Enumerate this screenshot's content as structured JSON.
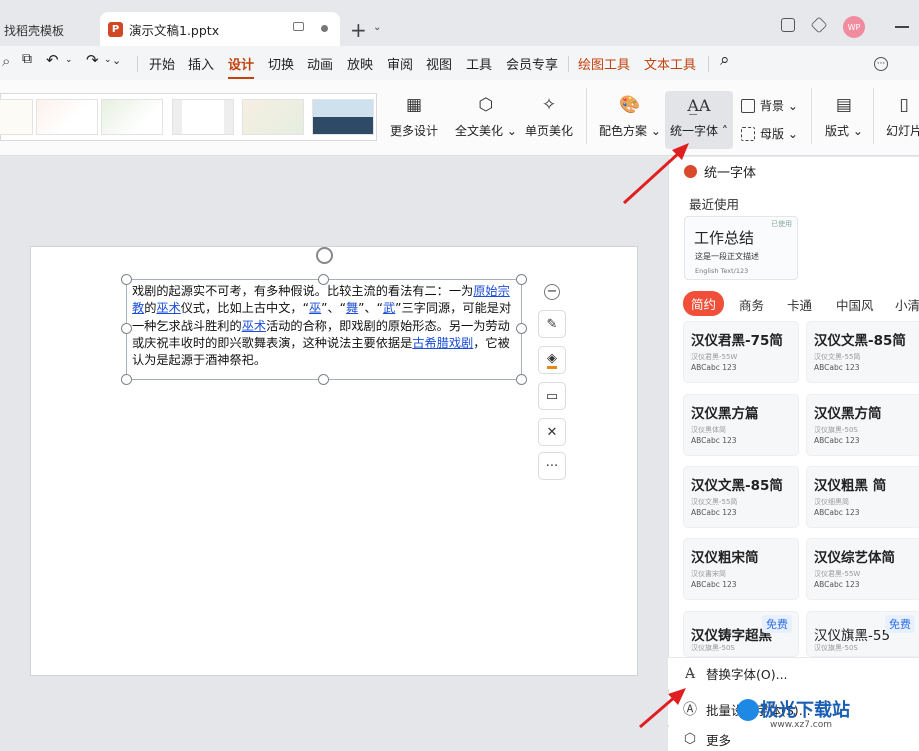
{
  "tabs": {
    "inactive_label": "找稻壳模板",
    "active_label": "演示文稿1.pptx",
    "ppt_icon": "P"
  },
  "menu": {
    "items": [
      "开始",
      "插入",
      "设计",
      "切换",
      "动画",
      "放映",
      "审阅",
      "视图",
      "工具",
      "会员专享"
    ],
    "active": "设计",
    "contextual": [
      "绘图工具",
      "文本工具"
    ]
  },
  "ribbon": {
    "more_design": "更多设计",
    "full_beautify": "全文美化",
    "single_beautify": "单页美化",
    "color_scheme": "配色方案",
    "unify_font": "统一字体",
    "background": "背景",
    "master": "母版",
    "layout": "版式",
    "slide_size": "幻灯片"
  },
  "slide": {
    "text_runs": [
      {
        "t": "戏剧的起源实不可考，有多种假说。比较主流的看法有二：一为"
      },
      {
        "t": "原始宗教",
        "link": true
      },
      {
        "t": "的"
      },
      {
        "t": "巫术",
        "link": true
      },
      {
        "t": "仪式，比如上古中文，“"
      },
      {
        "t": "巫",
        "link": true
      },
      {
        "t": "”、“"
      },
      {
        "t": "舞",
        "link": true
      },
      {
        "t": "”、“"
      },
      {
        "t": "武",
        "link": true
      },
      {
        "t": "”三字同源，可能是对一种乞求战斗胜利的"
      },
      {
        "t": "巫术",
        "link": true
      },
      {
        "t": "活动的合称，即戏剧的原始形态。另一为劳动或庆祝丰收时的即兴歌舞表演，这种说法主要依据是"
      },
      {
        "t": "古希腊戏剧",
        "link": true
      },
      {
        "t": "，它被认为是起源于酒神祭祀。"
      }
    ]
  },
  "panel": {
    "title": "统一字体",
    "recent_label": "最近使用",
    "recent_card": {
      "name": "工作总结",
      "sample": "这是一段正文描述",
      "english": "English Text/123",
      "tag": "已使用"
    },
    "categories": [
      "简约",
      "商务",
      "卡通",
      "中国风",
      "小清"
    ],
    "active_category": "简约",
    "fonts": [
      {
        "name": "汉仪君黑-75简",
        "sub": "汉仪君黑-55W",
        "eng": "ABCabc 123",
        "badge": ""
      },
      {
        "name": "汉仪文黑-85简",
        "sub": "汉仪文黑-55简",
        "eng": "ABCabc 123",
        "badge": ""
      },
      {
        "name": "汉仪黑方篇",
        "sub": "汉仪黑体简",
        "eng": "ABCabc 123",
        "badge": ""
      },
      {
        "name": "汉仪黑方简",
        "sub": "汉仪旗黑-50S",
        "eng": "ABCabc 123",
        "badge": ""
      },
      {
        "name": "汉仪文黑-85简",
        "sub": "汉仪文黑-55简",
        "eng": "ABCabc 123",
        "badge": ""
      },
      {
        "name": "汉仪粗黑 简",
        "sub": "汉仪细黑简",
        "eng": "ABCabc 123",
        "badge": ""
      },
      {
        "name": "汉仪粗宋简",
        "sub": "汉仪書宋简",
        "eng": "ABCabc 123",
        "badge": ""
      },
      {
        "name": "汉仪综艺体简",
        "sub": "汉仪君黑-55W",
        "eng": "ABCabc 123",
        "badge": ""
      },
      {
        "name": "汉仪铸字超黑",
        "sub": "汉仪旗黑-50S",
        "eng": "",
        "badge": "免费"
      },
      {
        "name": "汉仪旗黑-55",
        "sub": "汉仪旗黑-50S",
        "eng": "",
        "badge": "免费"
      }
    ],
    "replace_font": "替换字体(O)...",
    "batch_font": "批量设置字体(S)...",
    "more": "更多"
  },
  "watermark": {
    "name": "极光下载站",
    "url": "www.xz7.com"
  }
}
